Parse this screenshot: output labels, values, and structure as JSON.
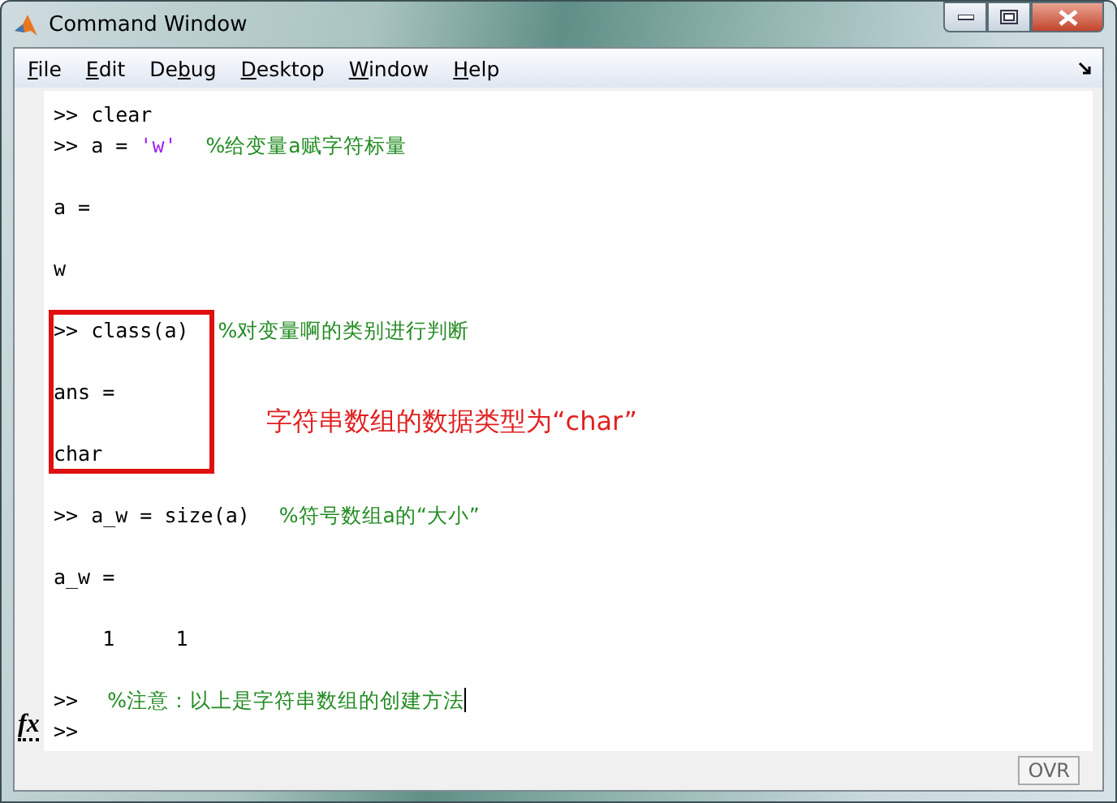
{
  "window": {
    "title": "Command Window"
  },
  "menu": [
    {
      "parts": [
        {
          "text": "F",
          "underlined": true
        },
        {
          "text": "ile",
          "underlined": false
        }
      ]
    },
    {
      "parts": [
        {
          "text": "E",
          "underlined": true
        },
        {
          "text": "dit",
          "underlined": false
        }
      ]
    },
    {
      "parts": [
        {
          "text": "De",
          "underlined": false
        },
        {
          "text": "b",
          "underlined": true
        },
        {
          "text": "ug",
          "underlined": false
        }
      ]
    },
    {
      "parts": [
        {
          "text": "D",
          "underlined": true
        },
        {
          "text": "esktop",
          "underlined": false
        }
      ]
    },
    {
      "parts": [
        {
          "text": "W",
          "underlined": true
        },
        {
          "text": "indow",
          "underlined": false
        }
      ]
    },
    {
      "parts": [
        {
          "text": "H",
          "underlined": true
        },
        {
          "text": "elp",
          "underlined": false
        }
      ]
    }
  ],
  "console": [
    {
      "kind": "line",
      "segments": [
        {
          "kind": "prompt",
          "text": ">>"
        },
        {
          "kind": "code",
          "text": "clear"
        }
      ]
    },
    {
      "kind": "line",
      "segments": [
        {
          "kind": "prompt",
          "text": ">>"
        },
        {
          "kind": "code",
          "text": "a = "
        },
        {
          "kind": "string",
          "text": "'w'"
        },
        {
          "kind": "comment",
          "text": "%给变量a赋字符标量"
        }
      ]
    },
    {
      "kind": "blank"
    },
    {
      "kind": "line",
      "segments": [
        {
          "kind": "code",
          "text": "a ="
        }
      ]
    },
    {
      "kind": "blank"
    },
    {
      "kind": "line",
      "segments": [
        {
          "kind": "code",
          "text": "w"
        }
      ]
    },
    {
      "kind": "blank"
    },
    {
      "kind": "group",
      "outlined": true,
      "annotation": "字符串数组的数据类型为“char”",
      "lines": [
        {
          "kind": "line",
          "segments": [
            {
              "kind": "prompt",
              "text": ">>"
            },
            {
              "kind": "code",
              "text": "class(a)"
            },
            {
              "kind": "comment",
              "text": "%对变量啊的类别进行判断"
            }
          ]
        },
        {
          "kind": "blank"
        },
        {
          "kind": "line",
          "segments": [
            {
              "kind": "code",
              "text": "ans ="
            }
          ]
        },
        {
          "kind": "blank"
        },
        {
          "kind": "line",
          "segments": [
            {
              "kind": "code",
              "text": "char"
            }
          ]
        }
      ]
    },
    {
      "kind": "blank"
    },
    {
      "kind": "line",
      "segments": [
        {
          "kind": "prompt",
          "text": ">>"
        },
        {
          "kind": "code",
          "text": "a_w = size(a)"
        },
        {
          "kind": "comment",
          "text": "%符号数组a的“大小”"
        }
      ]
    },
    {
      "kind": "blank"
    },
    {
      "kind": "line",
      "segments": [
        {
          "kind": "code",
          "text": "a_w ="
        }
      ]
    },
    {
      "kind": "blank"
    },
    {
      "kind": "line",
      "segments": [
        {
          "kind": "code",
          "text": "    1     1"
        }
      ]
    },
    {
      "kind": "blank"
    },
    {
      "kind": "line",
      "segments": [
        {
          "kind": "prompt",
          "text": ">>"
        },
        {
          "kind": "comment",
          "text": "%注意：以上是字符串数组的创建方法"
        }
      ],
      "cursor": true
    },
    {
      "kind": "line",
      "segments": [
        {
          "kind": "prompt",
          "text": ">>"
        }
      ],
      "gutter_icon": "fx"
    }
  ],
  "status_bar": {
    "indicator": "OVR"
  }
}
